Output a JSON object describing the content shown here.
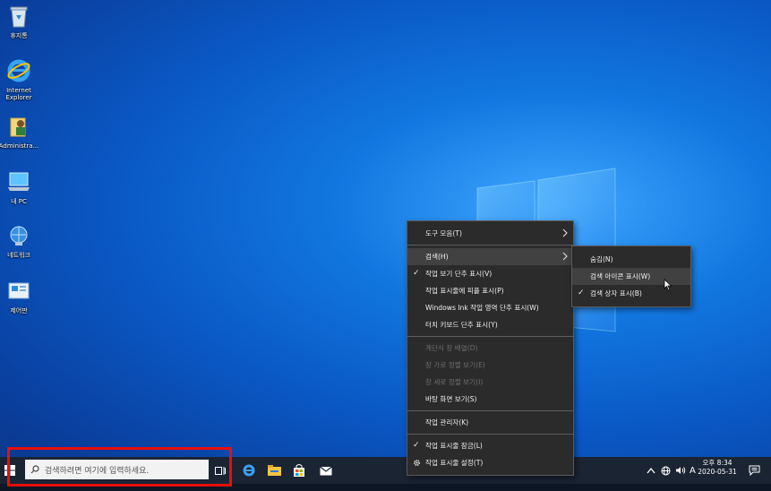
{
  "desktop": {
    "icons": [
      {
        "name": "recycle-bin",
        "label": "휴지통"
      },
      {
        "name": "internet-explorer",
        "label": "Internet\nExplorer"
      },
      {
        "name": "administrator-folder",
        "label": "Administra..."
      },
      {
        "name": "my-pc",
        "label": "내 PC"
      },
      {
        "name": "network",
        "label": "네트워크"
      },
      {
        "name": "control-panel",
        "label": "제어판"
      }
    ]
  },
  "context_menu": {
    "items": [
      {
        "label": "도구 모음(T)",
        "submenu": true
      },
      {
        "label": "검색(H)",
        "submenu": true,
        "hover": true
      },
      {
        "label": "작업 보기 단추 표시(V)",
        "checked": true
      },
      {
        "label": "작업 표시줄에 피플 표시(P)"
      },
      {
        "label": "Windows Ink 작업 영역 단추 표시(W)"
      },
      {
        "label": "터치 키보드 단추 표시(Y)"
      },
      {
        "label": "계단식 창 배열(D)",
        "disabled": true
      },
      {
        "label": "창 가로 정렬 보기(E)",
        "disabled": true
      },
      {
        "label": "창 세로 정렬 보기(I)",
        "disabled": true
      },
      {
        "label": "바탕 화면 보기(S)"
      },
      {
        "label": "작업 관리자(K)"
      },
      {
        "label": "작업 표시줄 잠금(L)",
        "checked": true
      },
      {
        "label": "작업 표시줄 설정(T)",
        "icon": "gear-icon"
      }
    ]
  },
  "search_submenu": {
    "items": [
      {
        "label": "숨김(N)"
      },
      {
        "label": "검색 아이콘 표시(W)",
        "hover": true
      },
      {
        "label": "검색 상자 표시(B)",
        "checked": true
      }
    ]
  },
  "taskbar": {
    "search_placeholder": "검색하려면 여기에 입력하세요.",
    "pinned": [
      "task-view-icon",
      "edge-icon",
      "file-explorer-icon",
      "store-icon",
      "mail-icon"
    ],
    "tray": {
      "ime": "A",
      "clock_period_time": "오후 8:34",
      "date": "2020-05-31"
    }
  },
  "colors": {
    "highlight": "#ea0d0d",
    "taskbar": "#1b2433",
    "menu_bg": "#2b2b2b"
  }
}
